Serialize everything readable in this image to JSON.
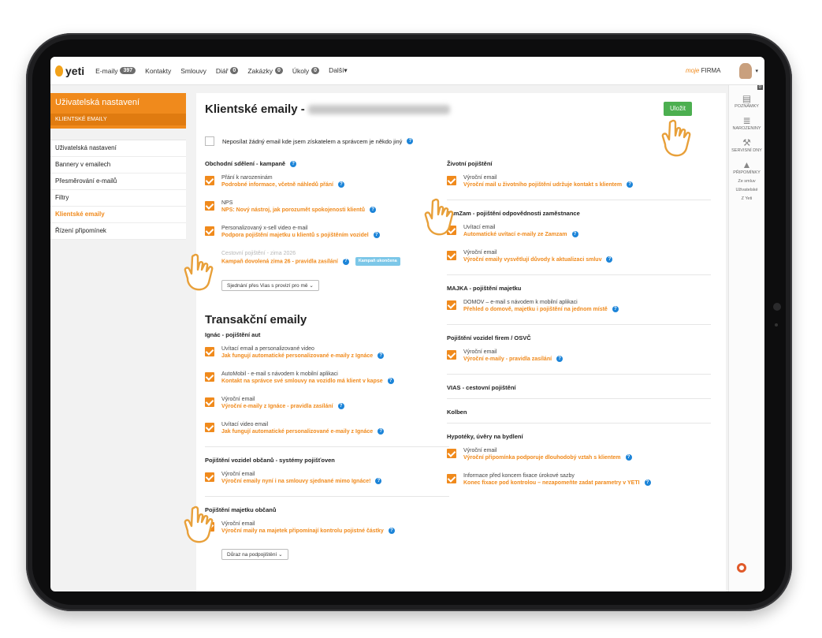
{
  "nav": {
    "logo": "yeti",
    "items": [
      {
        "label": "E-maily",
        "badge": "397"
      },
      {
        "label": "Kontakty",
        "badge": ""
      },
      {
        "label": "Smlouvy",
        "badge": ""
      },
      {
        "label": "Diář",
        "badge": "0"
      },
      {
        "label": "Zakázky",
        "badge": "0"
      },
      {
        "label": "Úkoly",
        "badge": "0"
      },
      {
        "label": "Další▾",
        "badge": ""
      }
    ],
    "firma_prefix": "moje",
    "firma": "FIRMA"
  },
  "sidebar": {
    "title": "Uživatelská nastavení",
    "subtitle": "KLIENTSKÉ EMAILY",
    "links": [
      "Uživatelská nastavení",
      "Bannery v emailech",
      "Přesměrování e-mailů",
      "Filtry",
      "Klientské emaily",
      "Řízení připomínek"
    ],
    "active_index": 4
  },
  "rail": {
    "badge": "0",
    "items": [
      "POZNÁMKY",
      "NAROZENINY",
      "SERVISNÍ DNY",
      "PŘIPOMÍNKY"
    ],
    "subs": [
      "Ze smluv",
      "Uživatelské",
      "Z Yeti"
    ]
  },
  "page": {
    "title": "Klientské emaily -",
    "save": "Uložit",
    "no_email": "Neposílat žádný email kde jsem získatelem a správcem je někdo jiný"
  },
  "left": {
    "campaign_title": "Obchodní sdělení - kampaně",
    "campaign_items": [
      {
        "title": "Přání k narozeninám",
        "sub": "Podrobné informace, včetně náhledů přání"
      },
      {
        "title": "NPS",
        "sub": "NPS: Nový nástroj, jak porozumět spokojenosti klientů"
      },
      {
        "title": "Personalizovaný x-sell video e-mail",
        "sub": "Podpora pojištění majetku u klientů s pojištěním vozidel"
      },
      {
        "title": "Cestovní pojištění - zima 2026",
        "sub": "Kampaň dovolená zima 26 - pravidla zasílání",
        "pill": "Kampaň ukončena"
      }
    ],
    "campaign_select": "Sjednání přes Vias s provizí pro mě",
    "trans_title": "Transakční emaily",
    "ignac_title": "Ignác - pojištění aut",
    "ignac_items": [
      {
        "title": "Uvítací email a personalizované video",
        "sub": "Jak fungují automatické personalizované e-maily z Ignáce"
      },
      {
        "title": "AutoMobil - e-mail s návodem k mobilní aplikaci",
        "sub": "Kontakt na správce své smlouvy na vozidlo má klient v kapse"
      },
      {
        "title": "Výroční email",
        "sub": "Výroční e-maily z Ignáce - pravidla zasílání"
      },
      {
        "title": "Uvítací video email",
        "sub": "Jak fungují automatické personalizované e-maily z Ignáce"
      }
    ],
    "vozidla_title": "Pojištění vozidel občanů - systémy pojišťoven",
    "vozidla_items": [
      {
        "title": "Výroční email",
        "sub": "Výroční emaily nyní i na smlouvy sjednané mimo Ignáce!"
      }
    ],
    "majetek_title": "Pojištění majetku občanů",
    "majetek_items": [
      {
        "title": "Výroční email",
        "sub": "Výroční maily na majetek připomínají kontrolu pojistné částky"
      }
    ],
    "majetek_select": "Důraz na podpojištění"
  },
  "right": {
    "zivot_title": "Životní pojištění",
    "zivot_items": [
      {
        "title": "Výroční email",
        "sub": "Výroční mail u životního pojištění udržuje kontakt s klientem"
      }
    ],
    "zamzam_title": "ZamZam - pojištění odpovědnosti zaměstnance",
    "zamzam_items": [
      {
        "title": "Uvítací email",
        "sub": "Automatické uvítací e-maily ze Zamzam"
      },
      {
        "title": "Výroční email",
        "sub": "Výroční emaily vysvětlují důvody k aktualizaci smluv"
      }
    ],
    "majka_title": "MAJKA - pojištění majetku",
    "majka_items": [
      {
        "title": "DOMOV – e-mail s návodem k mobilní aplikaci",
        "sub": "Přehled o domově, majetku i pojištění na jednom místě"
      }
    ],
    "firmy_title": "Pojištění vozidel firem / OSVČ",
    "firmy_items": [
      {
        "title": "Výroční email",
        "sub": "Výroční e-maily - pravidla zasílání"
      }
    ],
    "vias_title": "VIAS - cestovní pojištění",
    "kolben_title": "Kolben",
    "hypo_title": "Hypotéky, úvěry na bydlení",
    "hypo_items": [
      {
        "title": "Výroční email",
        "sub": "Výroční připomínka podporuje dlouhodobý vztah s klientem"
      },
      {
        "title": "Informace před koncem fixace úrokové sazby",
        "sub": "Konec fixace pod kontrolou – nezapomeňte zadat parametry v YETI"
      }
    ]
  },
  "colors": {
    "accent": "#f08a1c",
    "save": "#4caf50",
    "help": "#1c84d8"
  }
}
